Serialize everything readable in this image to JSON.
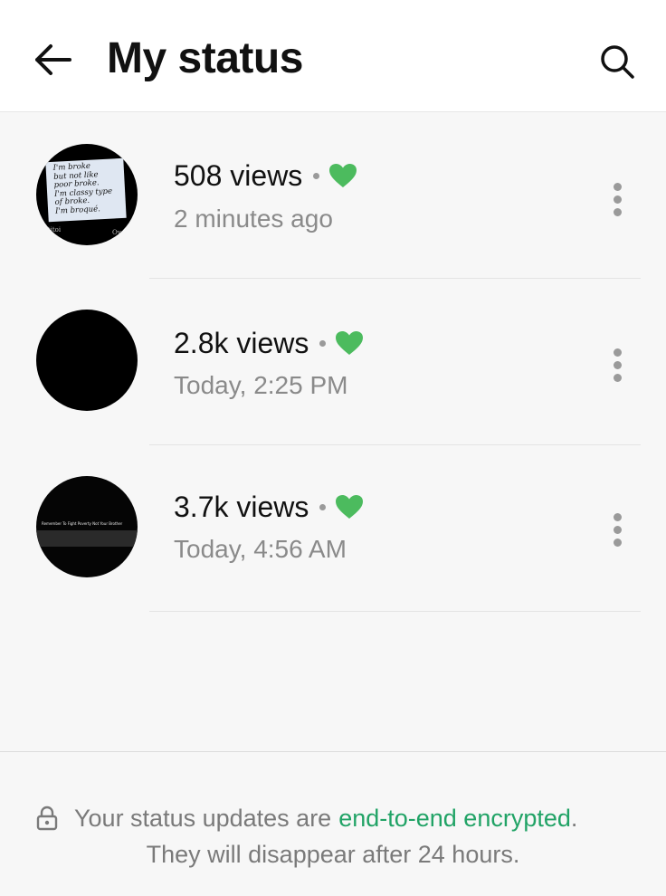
{
  "header": {
    "title": "My status",
    "back_icon": "arrow-left-icon",
    "search_icon": "search-icon"
  },
  "statuses": [
    {
      "views": "508 views",
      "time": "2 minutes ago",
      "thumbnail": {
        "lines": [
          "I'm broke",
          "but not like",
          "poor broke.",
          "I'm classy type",
          "of broke.",
          "I'm broqué."
        ],
        "footer_left": "ttitoi",
        "footer_right": "Ov"
      }
    },
    {
      "views": "2.8k views",
      "time": "Today, 2:25 PM"
    },
    {
      "views": "3.7k views",
      "time": "Today, 4:56 AM",
      "thumbnail": {
        "caption": "Remember To Fight Poverty Not Your Brother"
      }
    }
  ],
  "colors": {
    "heart": "#4cbb5e",
    "link": "#21a366",
    "list_background": "#f7f7f7"
  },
  "footer": {
    "text_before": "Your status updates are",
    "link_text": "end-to-end encrypted",
    "text_after": ".",
    "line2": "They will disappear after 24 hours.",
    "lock_icon": "lock-icon"
  }
}
